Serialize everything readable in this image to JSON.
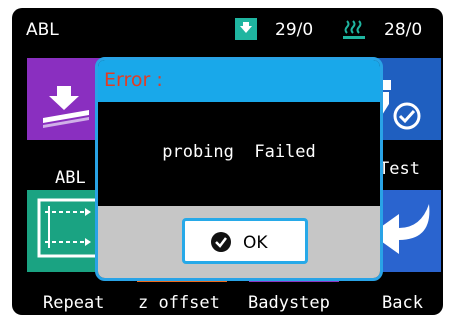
{
  "status_bar": {
    "title": "ABL",
    "nozzle_temp": "29/0",
    "bed_temp": "28/0"
  },
  "tiles": {
    "abl_label": "ABL",
    "test_label": "Test",
    "repeat_label": "Repeat",
    "z_offset_label": "z offset",
    "babystep_label": "Badystep",
    "back_label": "Back"
  },
  "dialog": {
    "title": "Error :",
    "message": "probing  Failed",
    "ok_label": "OK"
  },
  "colors": {
    "title_bar": "#19a8ea",
    "error_text": "#e23d24",
    "abl_tile": "#8a2fc0",
    "test_tile": "#1f5fc0",
    "repeat_tile": "#1aa382",
    "back_tile": "#2a64cf"
  }
}
